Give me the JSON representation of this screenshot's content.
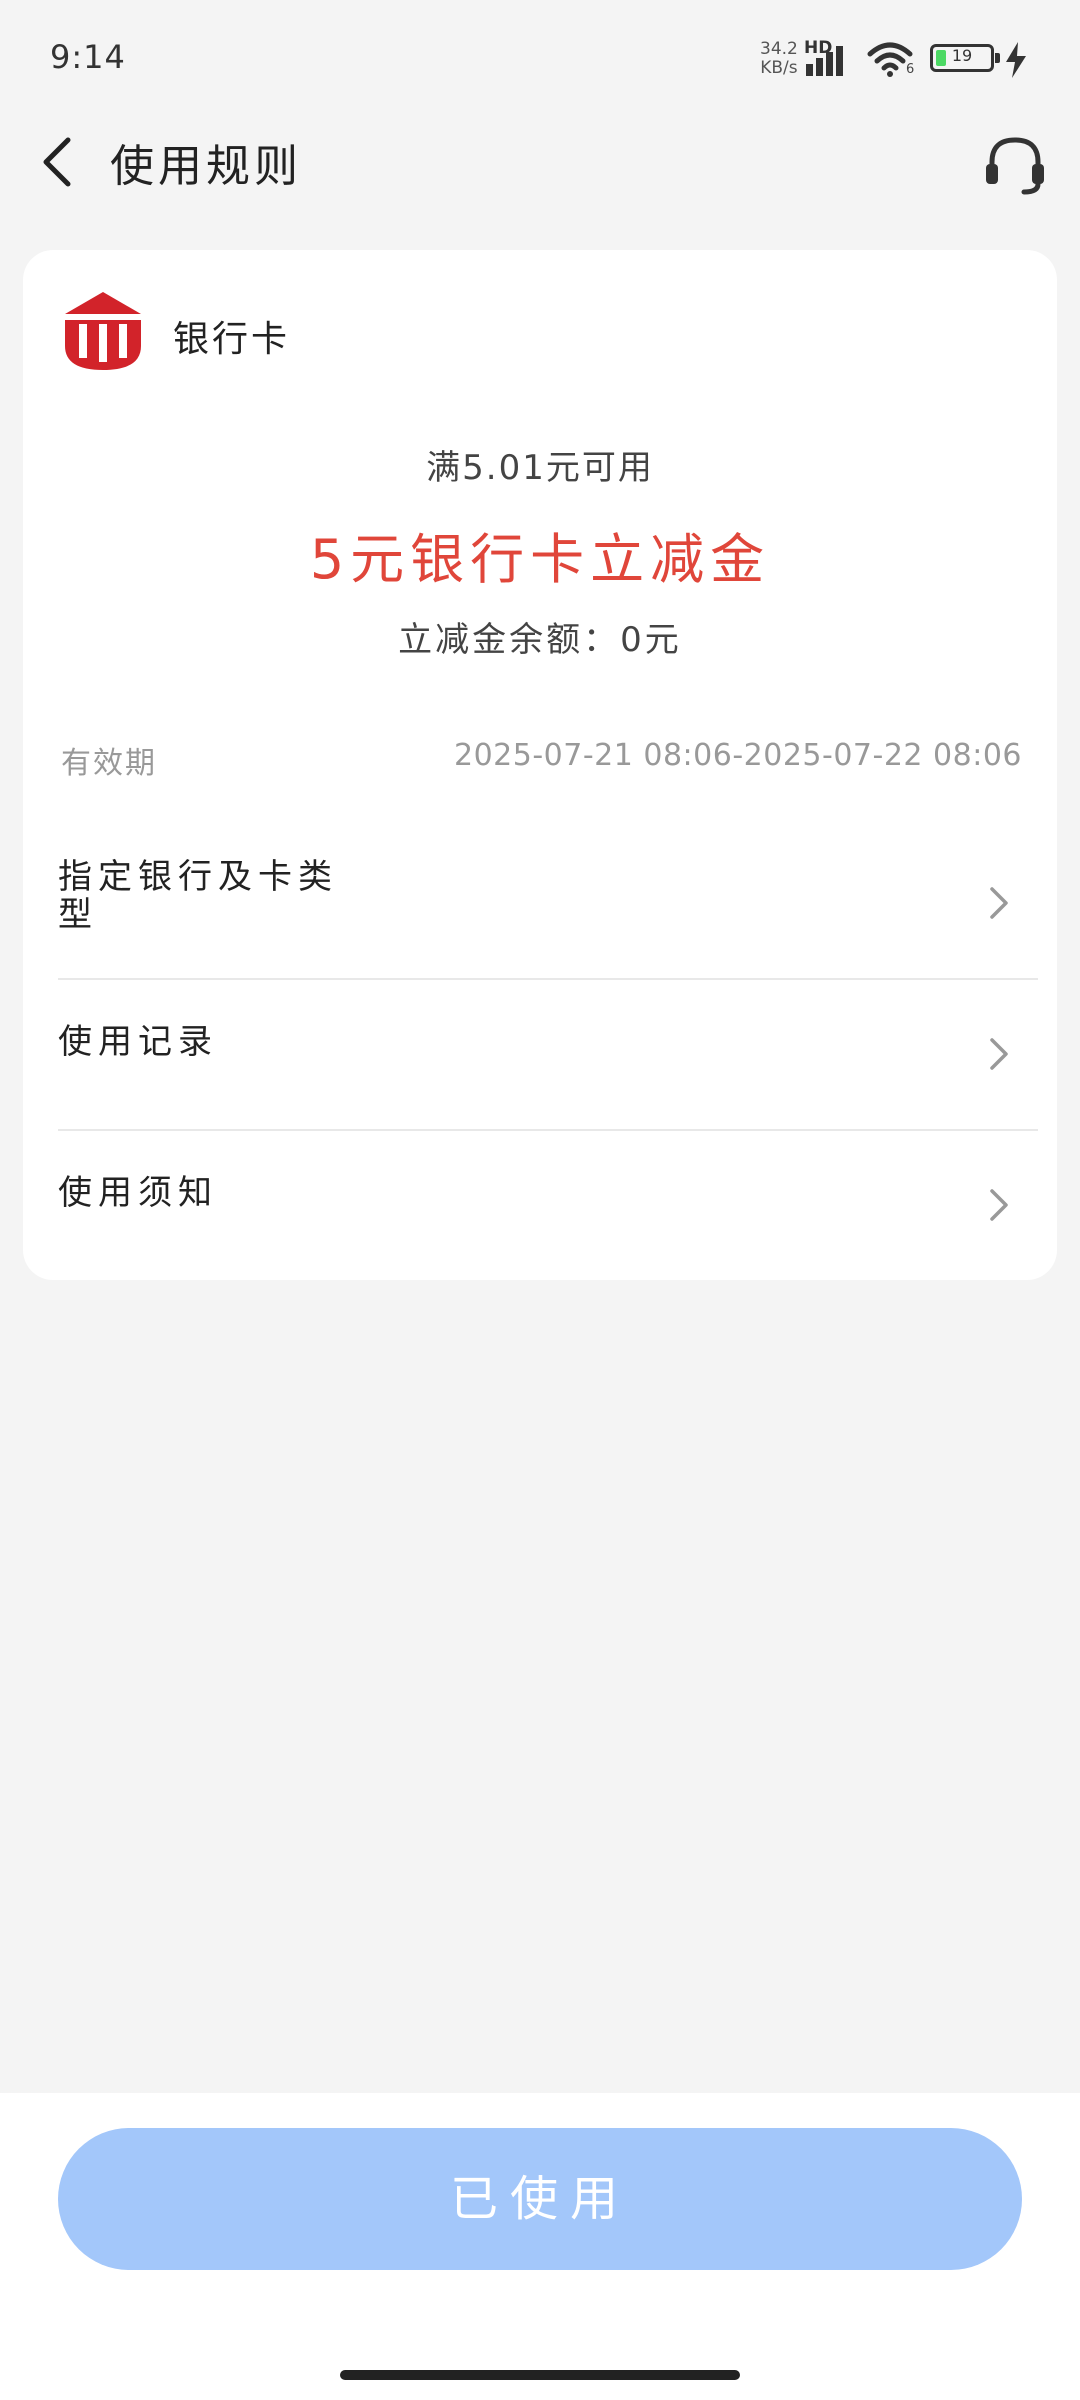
{
  "status_bar": {
    "time": "9:14",
    "net_speed_value": "34.2",
    "net_speed_unit": "KB/s",
    "network_type": "HD",
    "wifi_label": "6",
    "battery": "19"
  },
  "header": {
    "title": "使用规则",
    "back_icon": "back-arrow-icon",
    "service_icon": "headset-icon"
  },
  "card": {
    "source_name": "银行卡",
    "condition": "满5.01元可用",
    "coupon_title": "5元银行卡立减金",
    "balance": "立减金余额：0元",
    "validity_label": "有效期",
    "validity_value": "2025-07-21 08:06-2025-07-22 08:06",
    "rows": [
      {
        "label": "指定银行及卡类型"
      },
      {
        "label": "使用记录"
      },
      {
        "label": "使用须知"
      }
    ]
  },
  "bottom": {
    "button_label": "已使用"
  },
  "colors": {
    "accent_red": "#e0463a",
    "button_disabled": "#a3c7fa",
    "logo_red": "#d2232a"
  }
}
